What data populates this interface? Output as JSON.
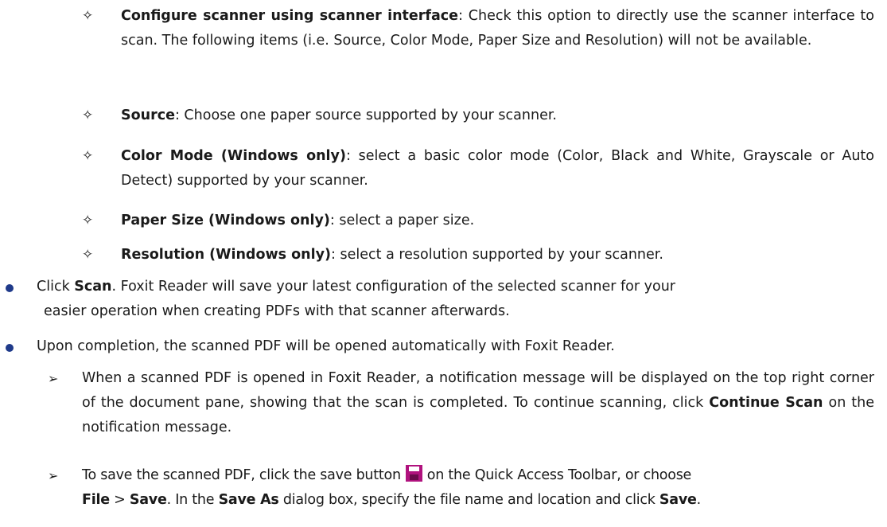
{
  "items": [
    {
      "marker": "✧",
      "title": "Configure scanner using scanner interface",
      "text": ": Check this option to directly use the scanner interface to scan. The following items (i.e. Source, Color Mode, Paper Size and Resolution) will not be available."
    },
    {
      "marker": "✧",
      "title": "Source",
      "text": ": Choose one paper source supported by your scanner."
    },
    {
      "marker": "✧",
      "title": "Color Mode (Windows only)",
      "text": ": select a basic color mode (Color, Black and White, Grayscale or Auto Detect) supported by your scanner."
    },
    {
      "marker": "✧",
      "title": "Paper Size (Windows only)",
      "text": ": select a paper size."
    },
    {
      "marker": "✧",
      "title": "Resolution (Windows only)",
      "text": ": select a resolution supported by your scanner."
    }
  ],
  "scan": {
    "pre": "Click ",
    "bold": "Scan",
    "line1_rest": ". Foxit Reader will save your latest configuration of the selected scanner for your",
    "line2": "easier operation when creating PDFs with that scanner afterwards."
  },
  "completion": {
    "text": "Upon completion, the scanned PDF will be opened automatically with Foxit Reader."
  },
  "notification": {
    "marker": "➢",
    "text": "When a scanned PDF is opened in Foxit Reader, a notification message will be displayed on the top right corner of the document pane, showing that the scan is completed. To continue scanning, click ",
    "bold": "Continue Scan",
    "rest": " on the notification message."
  },
  "save": {
    "marker": "➢",
    "pre": "To save the scanned PDF, click the save button",
    "post": "on the Quick Access Toolbar, or choose",
    "file": "File",
    "sep": " > ",
    "save": "Save",
    "mid": ". In the ",
    "saveas": "Save As",
    "mid2": " dialog box, specify the file name and location and click ",
    "save2": "Save",
    "end": "."
  },
  "colors": {
    "bullet": "#1f3a8a",
    "save_icon": "#b0127e"
  }
}
